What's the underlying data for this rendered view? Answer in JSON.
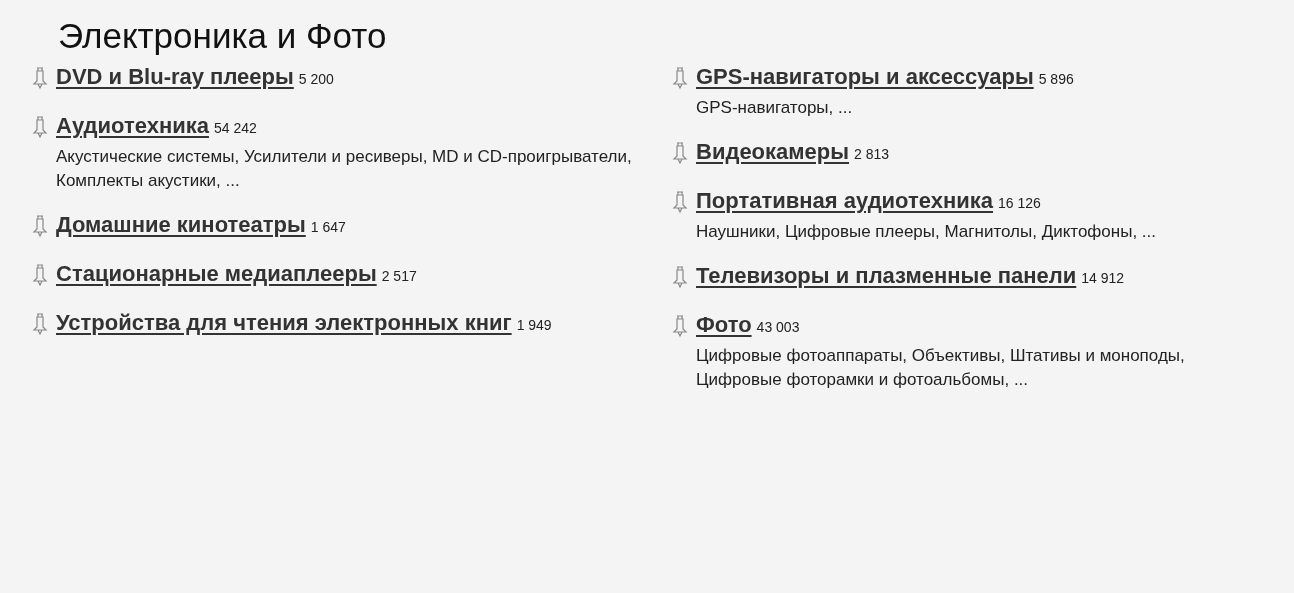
{
  "title": "Электроника и Фото",
  "columns": [
    [
      {
        "name": "DVD и Blu-ray плееры",
        "count": "5 200"
      },
      {
        "name": "Аудиотехника",
        "count": "54 242",
        "subcategories": "Акустические системы, Усилители и ресиверы, MD и CD-проигрыватели, Комплекты акустики, ..."
      },
      {
        "name": "Домашние кинотеатры",
        "count": "1 647"
      },
      {
        "name": "Стационарные медиаплееры",
        "count": "2 517"
      },
      {
        "name": "Устройства для чтения электронных книг",
        "count": "1 949"
      }
    ],
    [
      {
        "name": "GPS-навигаторы и аксессуары",
        "count": "5 896",
        "subcategories": "GPS-навигаторы, ..."
      },
      {
        "name": "Видеокамеры",
        "count": "2 813"
      },
      {
        "name": "Портативная аудиотехника",
        "count": "16 126",
        "subcategories": "Наушники, Цифровые плееры, Магнитолы, Диктофоны, ..."
      },
      {
        "name": "Телевизоры и плазменные панели",
        "count": "14 912"
      },
      {
        "name": "Фото",
        "count": "43 003",
        "subcategories": "Цифровые фотоаппараты, Объективы, Штативы и моноподы, Цифровые фоторамки и фотоальбомы, ..."
      }
    ]
  ]
}
